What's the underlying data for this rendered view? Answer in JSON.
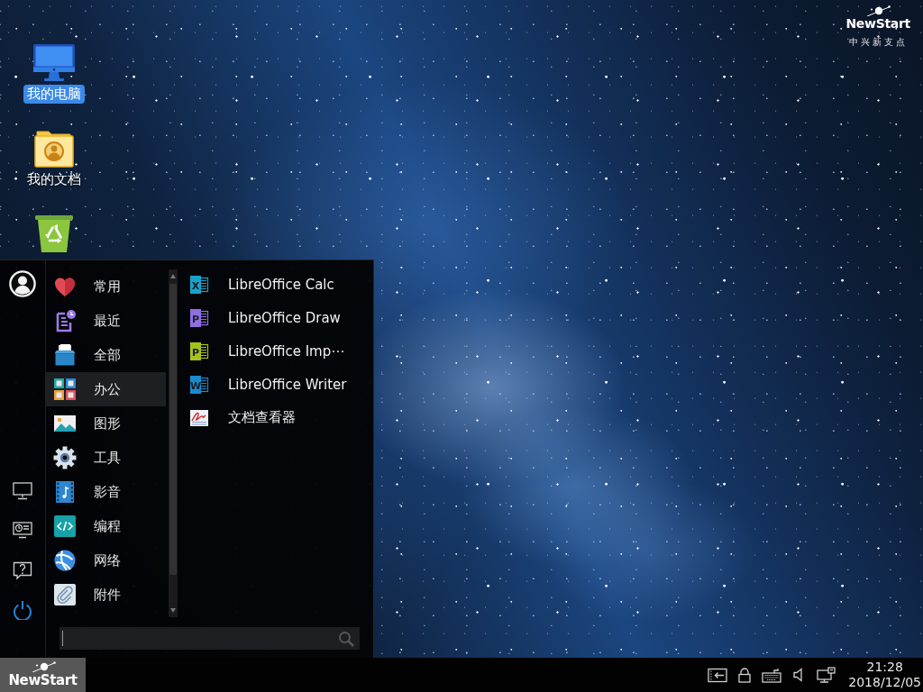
{
  "desktop": {
    "icons": [
      {
        "kind": "computer",
        "label": "我的电脑",
        "selected": true
      },
      {
        "kind": "documents",
        "label": "我的文档",
        "selected": false
      },
      {
        "kind": "trash",
        "selected": false
      }
    ],
    "brand": {
      "name": "NewStart",
      "tagline": "中兴新支点"
    }
  },
  "start_menu": {
    "categories": [
      {
        "kind": "favorites",
        "label": "常用",
        "selected": false
      },
      {
        "kind": "recent",
        "label": "最近",
        "selected": false
      },
      {
        "kind": "all",
        "label": "全部",
        "selected": false
      },
      {
        "kind": "office",
        "label": "办公",
        "selected": true
      },
      {
        "kind": "graphics",
        "label": "图形",
        "selected": false
      },
      {
        "kind": "tools",
        "label": "工具",
        "selected": false
      },
      {
        "kind": "media",
        "label": "影音",
        "selected": false
      },
      {
        "kind": "development",
        "label": "编程",
        "selected": false
      },
      {
        "kind": "network",
        "label": "网络",
        "selected": false
      },
      {
        "kind": "accessories",
        "label": "附件",
        "selected": false
      }
    ],
    "apps": [
      {
        "kind": "spreadsheet",
        "icon_letter": "X",
        "label": "LibreOffice Calc"
      },
      {
        "kind": "drawing",
        "icon_letter": "P",
        "label": "LibreOffice Draw"
      },
      {
        "kind": "presentation",
        "icon_letter": "P",
        "label": "LibreOffice Imp⋯"
      },
      {
        "kind": "text-document",
        "icon_letter": "W",
        "label": "LibreOffice Writer"
      },
      {
        "kind": "document-viewer",
        "label": "文档查看器"
      }
    ],
    "search": {
      "focused": true
    }
  },
  "taskbar": {
    "start_button": {
      "label": "NewStart"
    },
    "clock": {
      "time": "21:28",
      "date": "2018/12/05"
    }
  }
}
